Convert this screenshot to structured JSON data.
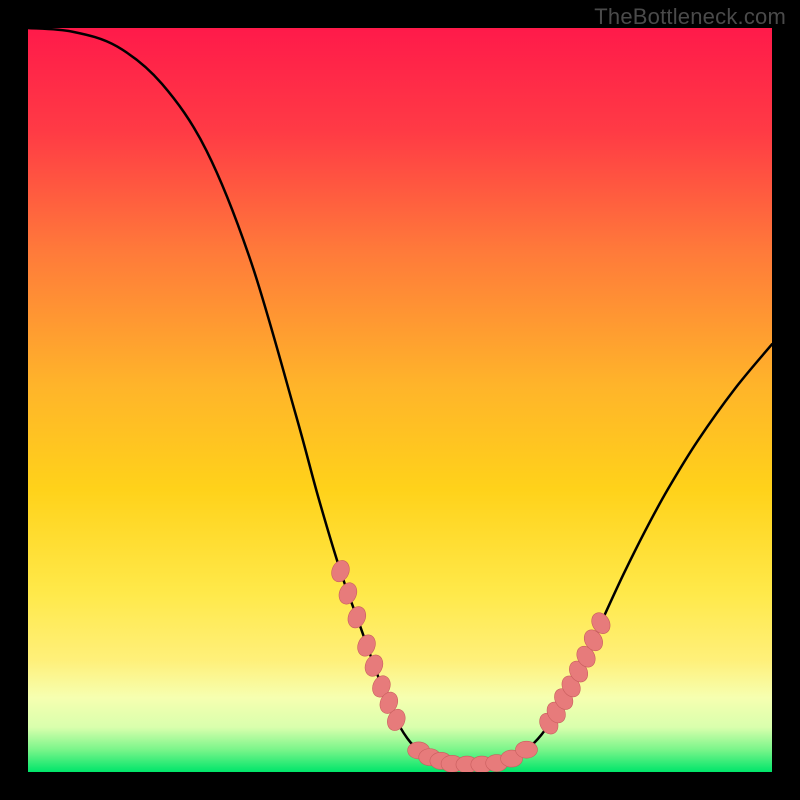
{
  "watermark": {
    "text": "TheBottleneck.com"
  },
  "colors": {
    "background": "#000000",
    "watermark_text": "#4a4a4a",
    "gradient_top": "#ff1a4a",
    "gradient_mid": "#ffd000",
    "gradient_low": "#fff07a",
    "gradient_band_pale": "#f6ffb0",
    "gradient_bottom": "#00e56a",
    "curve_stroke": "#000000",
    "marker_fill": "#e77b7b",
    "marker_stroke": "#c95e5e"
  },
  "chart_data": {
    "type": "line",
    "title": "",
    "xlabel": "",
    "ylabel": "",
    "xlim": [
      0,
      100
    ],
    "ylim": [
      0,
      100
    ],
    "grid": false,
    "legend_position": "none",
    "curve": [
      {
        "x": 0,
        "y": 100
      },
      {
        "x": 6,
        "y": 99.5
      },
      {
        "x": 12,
        "y": 97.5
      },
      {
        "x": 18,
        "y": 92.5
      },
      {
        "x": 24,
        "y": 83.5
      },
      {
        "x": 30,
        "y": 68.5
      },
      {
        "x": 36,
        "y": 48.0
      },
      {
        "x": 39,
        "y": 37.0
      },
      {
        "x": 42,
        "y": 27.0
      },
      {
        "x": 44.5,
        "y": 20.0
      },
      {
        "x": 47,
        "y": 13.0
      },
      {
        "x": 49,
        "y": 8.0
      },
      {
        "x": 51,
        "y": 4.5
      },
      {
        "x": 53,
        "y": 2.5
      },
      {
        "x": 55,
        "y": 1.5
      },
      {
        "x": 57,
        "y": 1.0
      },
      {
        "x": 59,
        "y": 1.0
      },
      {
        "x": 61,
        "y": 1.0
      },
      {
        "x": 63,
        "y": 1.2
      },
      {
        "x": 65,
        "y": 1.8
      },
      {
        "x": 67,
        "y": 3.0
      },
      {
        "x": 69,
        "y": 5.0
      },
      {
        "x": 71,
        "y": 8.0
      },
      {
        "x": 73,
        "y": 11.5
      },
      {
        "x": 75,
        "y": 15.5
      },
      {
        "x": 77,
        "y": 20.0
      },
      {
        "x": 80,
        "y": 26.5
      },
      {
        "x": 83,
        "y": 32.5
      },
      {
        "x": 86,
        "y": 38.0
      },
      {
        "x": 90,
        "y": 44.5
      },
      {
        "x": 95,
        "y": 51.5
      },
      {
        "x": 100,
        "y": 57.5
      }
    ],
    "markers_left": [
      {
        "x": 42.0,
        "y": 27.0
      },
      {
        "x": 43.0,
        "y": 24.0
      },
      {
        "x": 44.2,
        "y": 20.8
      },
      {
        "x": 45.5,
        "y": 17.0
      },
      {
        "x": 46.5,
        "y": 14.3
      },
      {
        "x": 47.5,
        "y": 11.5
      },
      {
        "x": 48.5,
        "y": 9.3
      },
      {
        "x": 49.5,
        "y": 7.0
      }
    ],
    "markers_bottom": [
      {
        "x": 52.5,
        "y": 2.9
      },
      {
        "x": 54.0,
        "y": 2.0
      },
      {
        "x": 55.5,
        "y": 1.5
      },
      {
        "x": 57.0,
        "y": 1.1
      },
      {
        "x": 59.0,
        "y": 1.0
      },
      {
        "x": 61.0,
        "y": 1.0
      },
      {
        "x": 63.0,
        "y": 1.2
      },
      {
        "x": 65.0,
        "y": 1.8
      },
      {
        "x": 67.0,
        "y": 3.0
      }
    ],
    "markers_right": [
      {
        "x": 70.0,
        "y": 6.5
      },
      {
        "x": 71.0,
        "y": 8.0
      },
      {
        "x": 72.0,
        "y": 9.8
      },
      {
        "x": 73.0,
        "y": 11.5
      },
      {
        "x": 74.0,
        "y": 13.5
      },
      {
        "x": 75.0,
        "y": 15.5
      },
      {
        "x": 76.0,
        "y": 17.7
      },
      {
        "x": 77.0,
        "y": 20.0
      }
    ]
  }
}
